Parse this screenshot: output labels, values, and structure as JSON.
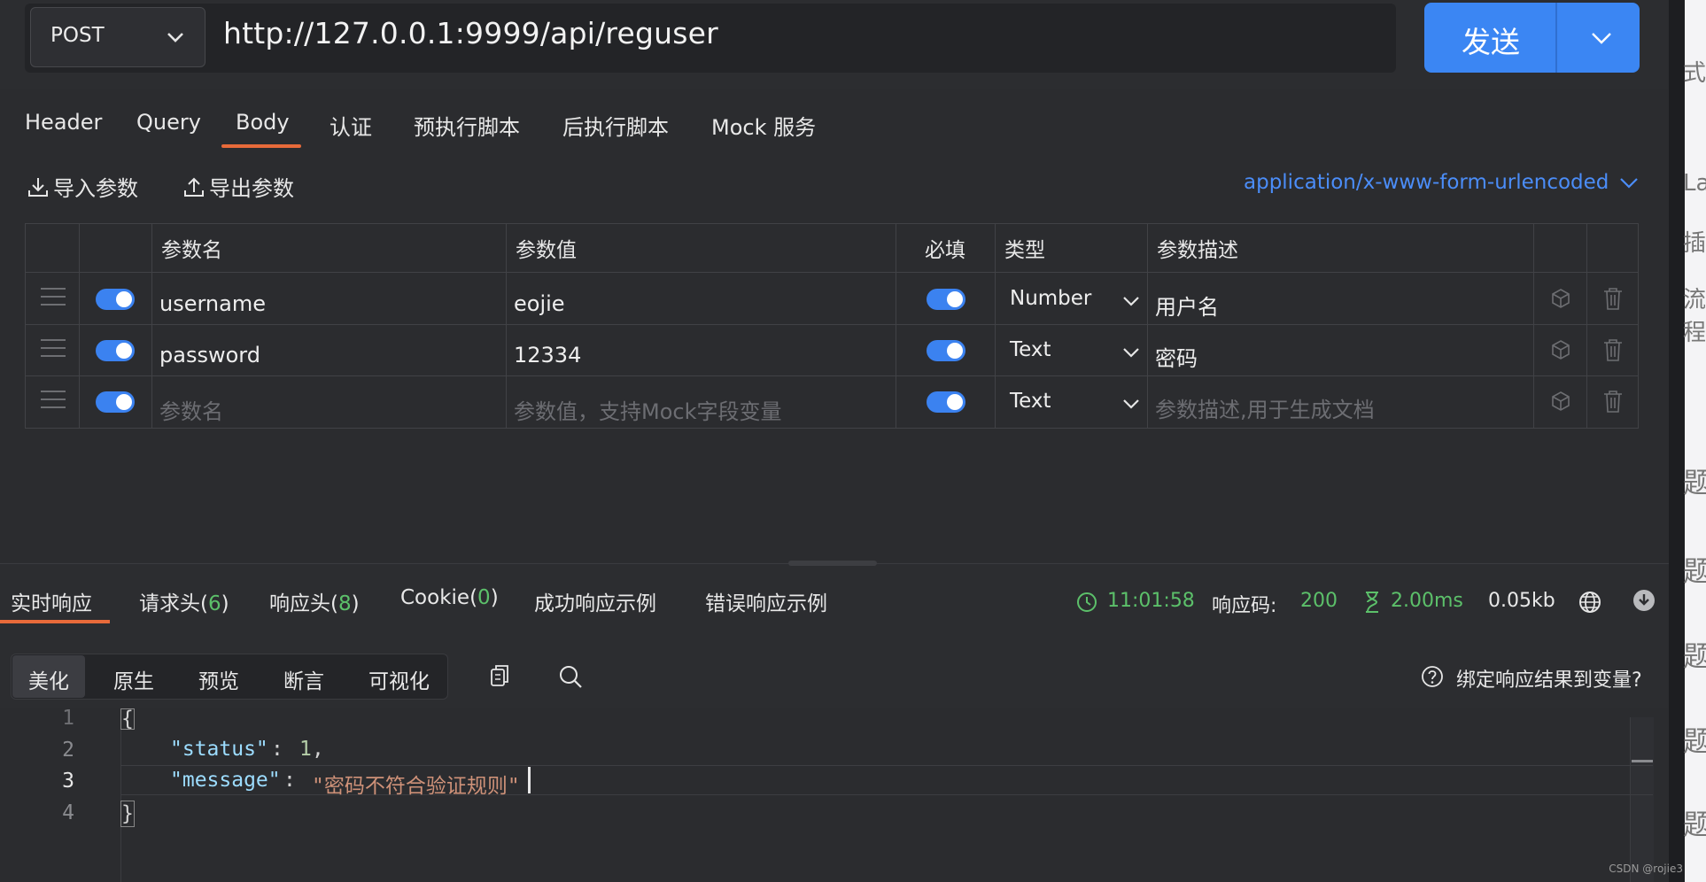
{
  "request": {
    "method": "POST",
    "url": "http://127.0.0.1:9999/api/reguser",
    "send_label": "发送"
  },
  "tabs": [
    "Header",
    "Query",
    "Body",
    "认证",
    "预执行脚本",
    "后执行脚本",
    "Mock 服务"
  ],
  "active_tab": "Body",
  "body_toolbar": {
    "import_label": "导入参数",
    "export_label": "导出参数",
    "content_type": "application/x-www-form-urlencoded"
  },
  "params_table": {
    "headers": {
      "name": "参数名",
      "value": "参数值",
      "required": "必填",
      "type": "类型",
      "description": "参数描述"
    },
    "rows": [
      {
        "enabled": true,
        "name": "username",
        "value": "eojie",
        "required": true,
        "type": "Number",
        "description": "用户名"
      },
      {
        "enabled": true,
        "name": "password",
        "value": "12334",
        "required": true,
        "type": "Text",
        "description": "密码"
      }
    ],
    "new_row": {
      "enabled": true,
      "name_placeholder": "参数名",
      "value_placeholder": "参数值，支持Mock字段变量",
      "required": true,
      "type": "Text",
      "description_placeholder": "参数描述,用于生成文档"
    }
  },
  "response": {
    "tabs": {
      "realtime": "实时响应",
      "req_headers": "请求头(",
      "req_headers_count": "6",
      "resp_headers": "响应头(",
      "resp_headers_count": "8",
      "cookie": "Cookie(",
      "cookie_count": "0",
      "close_paren": ")",
      "success_example": "成功响应示例",
      "error_example": "错误响应示例"
    },
    "time": "11:01:58",
    "status_label": "响应码:",
    "status_code": "200",
    "duration": "2.00ms",
    "size": "0.05kb",
    "view_modes": [
      "美化",
      "原生",
      "预览",
      "断言",
      "可视化"
    ],
    "active_view": "美化",
    "bind_label": "绑定响应结果到变量?",
    "code": {
      "line_numbers": [
        "1",
        "2",
        "3",
        "4"
      ],
      "open_brace": "{",
      "status_key": "\"status\"",
      "status_value": "1",
      "message_key": "\"message\"",
      "message_value": "\"密码不符合验证规则\"",
      "close_brace": "}"
    }
  },
  "right_edge_chars": [
    "式",
    "La",
    "插",
    "流程",
    "题",
    "题",
    "题",
    "题",
    "题"
  ],
  "watermark": "CSDN @rojie3",
  "colors": {
    "accent_blue": "#3b86f3",
    "tab_underline": "#e86a3a",
    "success_green": "#5cc06a",
    "link_blue": "#4b8df8"
  }
}
